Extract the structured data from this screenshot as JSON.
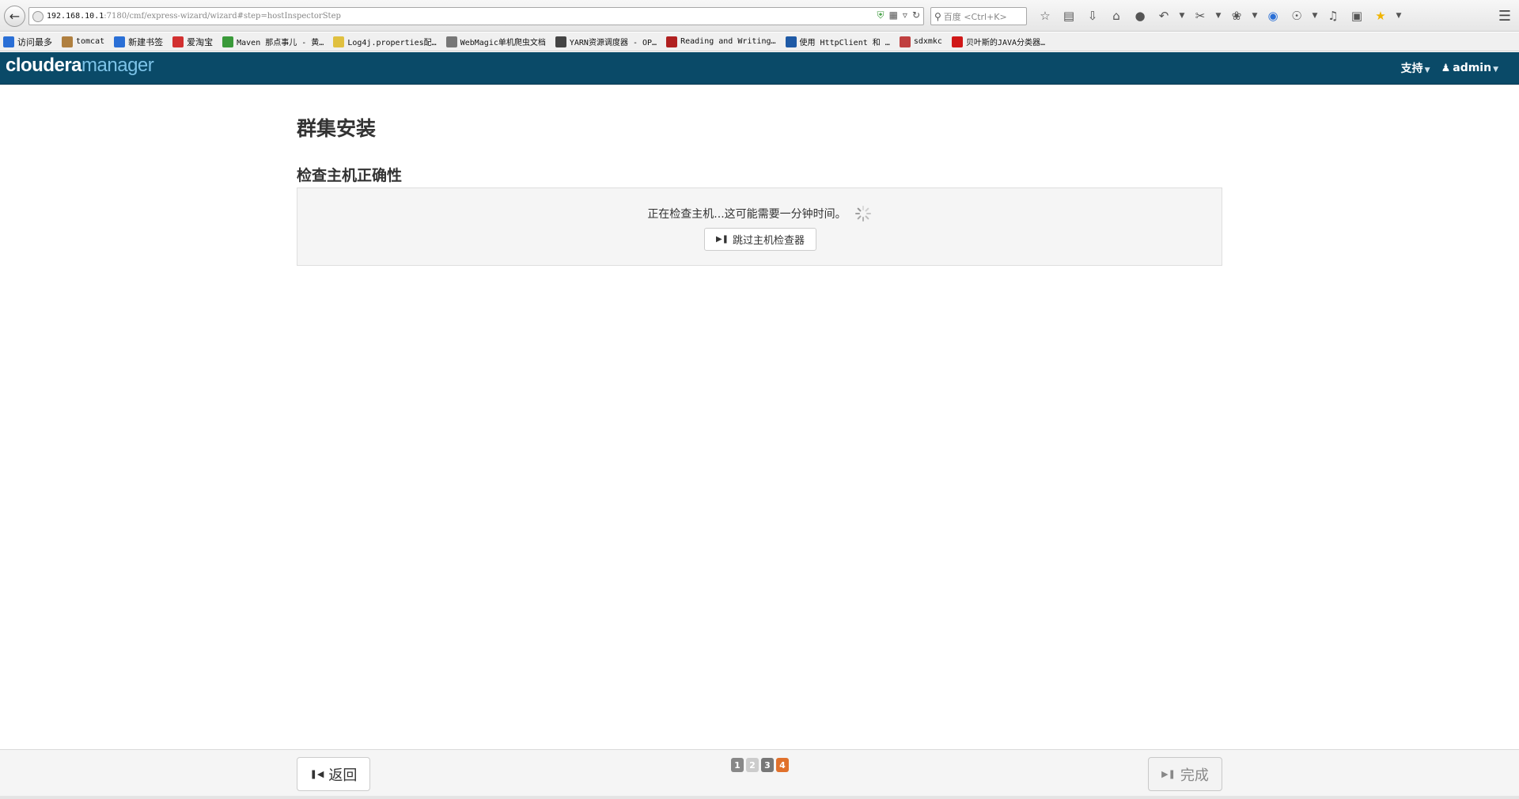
{
  "browser": {
    "url_host": "192.168.10.1",
    "url_rest": ":7180/cmf/express-wizard/wizard#step=hostInspectorStep",
    "search_placeholder": "百度 <Ctrl+K>"
  },
  "bookmarks": [
    {
      "label": "访问最多",
      "color": "#2a6fd6",
      "mono": false
    },
    {
      "label": "tomcat",
      "color": "#b08040",
      "mono": true
    },
    {
      "label": "新建书签",
      "color": "#2a6fd6",
      "mono": false
    },
    {
      "label": "爱淘宝",
      "color": "#d23030",
      "mono": false
    },
    {
      "label": "Maven 那点事儿 - 黄…",
      "color": "#3a9a3a",
      "mono": true
    },
    {
      "label": "Log4j.properties配…",
      "color": "#e0c040",
      "mono": true
    },
    {
      "label": "WebMagic单机爬虫文档",
      "color": "#777777",
      "mono": true
    },
    {
      "label": "YARN资源调度器 - OP…",
      "color": "#444444",
      "mono": true
    },
    {
      "label": "Reading and Writing…",
      "color": "#b02020",
      "mono": true
    },
    {
      "label": "使用 HttpClient 和 …",
      "color": "#1f5aa6",
      "mono": true
    },
    {
      "label": "sdxmkc",
      "color": "#c04040",
      "mono": true
    },
    {
      "label": "贝叶斯的JAVA分类器…",
      "color": "#d01818",
      "mono": true
    }
  ],
  "header": {
    "brand_part1": "cloudera",
    "brand_part2": "manager",
    "support_label": "支持",
    "user_label": "admin"
  },
  "main": {
    "page_title": "群集安装",
    "section_title": "检查主机正确性",
    "status_text": "正在检查主机...这可能需要一分钟时间。",
    "skip_button": "跳过主机检查器"
  },
  "footer": {
    "back_label": "返回",
    "done_label": "完成",
    "steps": [
      {
        "label": "1",
        "color": "#888888"
      },
      {
        "label": "2",
        "color": "#cccccc"
      },
      {
        "label": "3",
        "color": "#777777"
      },
      {
        "label": "4",
        "color": "#e0712c"
      }
    ]
  },
  "colors": {
    "header_bg": "#0a4a68",
    "brand_accent": "#7cc3e8",
    "active_step": "#e0712c"
  }
}
